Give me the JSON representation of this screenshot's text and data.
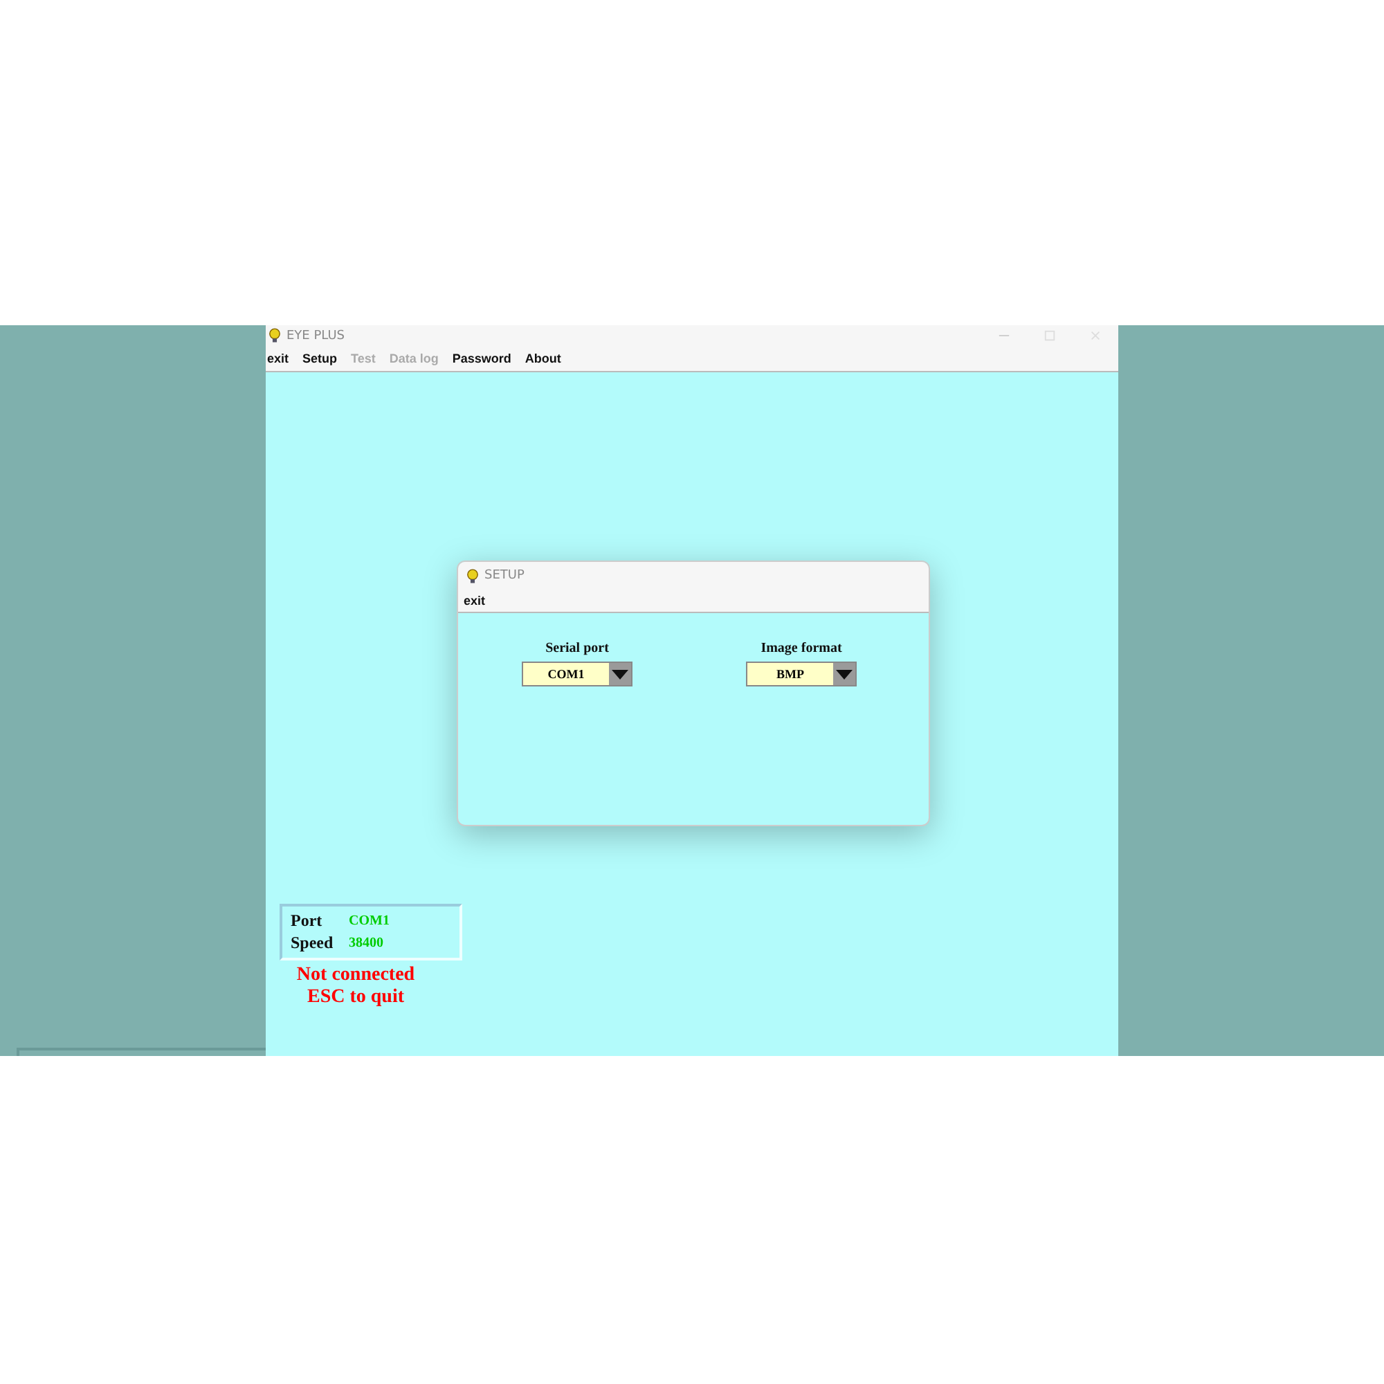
{
  "window": {
    "title": "EYE PLUS"
  },
  "menu": [
    {
      "label": "exit",
      "disabled": false
    },
    {
      "label": "Setup",
      "disabled": false
    },
    {
      "label": "Test",
      "disabled": true
    },
    {
      "label": "Data log",
      "disabled": true
    },
    {
      "label": "Password",
      "disabled": false
    },
    {
      "label": "About",
      "disabled": false
    }
  ],
  "dialog": {
    "title": "SETUP",
    "menu": [
      {
        "label": "exit",
        "disabled": false
      }
    ],
    "fields": [
      {
        "label": "Serial port",
        "value": "COM1"
      },
      {
        "label": "Image format",
        "value": "BMP"
      }
    ]
  },
  "status": {
    "rows": [
      {
        "label": "Port",
        "value": "COM1"
      },
      {
        "label": "Speed",
        "value": "38400"
      }
    ],
    "messages": [
      "Not connected",
      "ESC to quit"
    ]
  }
}
